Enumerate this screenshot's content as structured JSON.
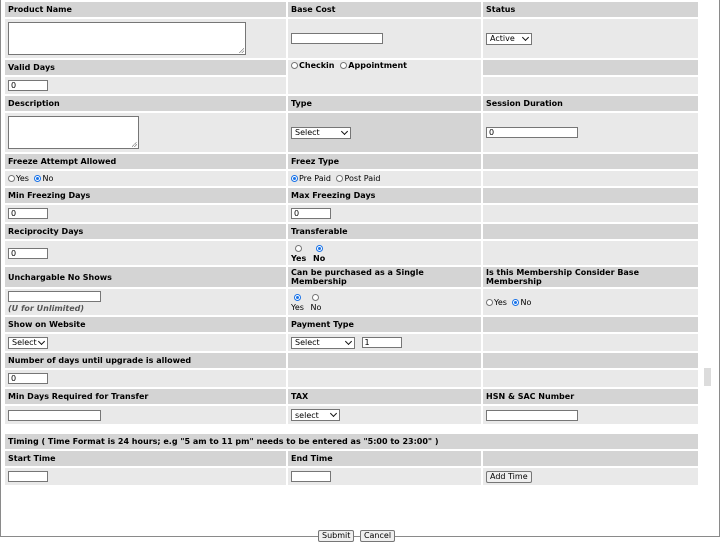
{
  "fields": {
    "product_name": "Product Name",
    "base_cost": "Base Cost",
    "status": "Status",
    "status_value": "Active",
    "valid_days": "Valid Days",
    "valid_days_value": "0",
    "checkin": "Checkin",
    "appointment": "Appointment",
    "description": "Description",
    "type": "Type",
    "type_value": "Select",
    "session_duration": "Session Duration",
    "session_duration_value": "0",
    "freeze_attempt": "Freeze Attempt Allowed",
    "freez_type": "Freez Type",
    "yes": "Yes",
    "no": "No",
    "pre_paid": "Pre Paid",
    "post_paid": "Post Paid",
    "min_freezing": "Min Freezing Days",
    "min_freezing_value": "0",
    "max_freezing": "Max Freezing Days",
    "max_freezing_value": "0",
    "reciprocity": "Reciprocity Days",
    "reciprocity_value": "0",
    "transferable": "Transferable",
    "unchargable": "Unchargable No Shows",
    "unchargable_note": "(U for Unlimited)",
    "single_membership": "Can be purchased as a Single Membership",
    "base_membership": "Is this Membership Consider Base Membership",
    "show_website": "Show on Website",
    "show_website_value": "Select",
    "payment_type": "Payment Type",
    "payment_type_value": "Select",
    "payment_qty": "1",
    "upgrade_days": "Number of days until upgrade is allowed",
    "upgrade_days_value": "0",
    "min_days_transfer": "Min Days Required for Transfer",
    "tax": "TAX",
    "tax_value": "select",
    "hsn": "HSN & SAC Number"
  },
  "timing": {
    "header": "Timing ( Time Format is 24 hours; e.g \"5 am to 11 pm\" needs to be entered as \"5:00 to 23:00\" )",
    "start_time": "Start Time",
    "end_time": "End Time",
    "add_time": "Add Time"
  },
  "actions": {
    "submit": "Submit",
    "cancel": "Cancel"
  }
}
